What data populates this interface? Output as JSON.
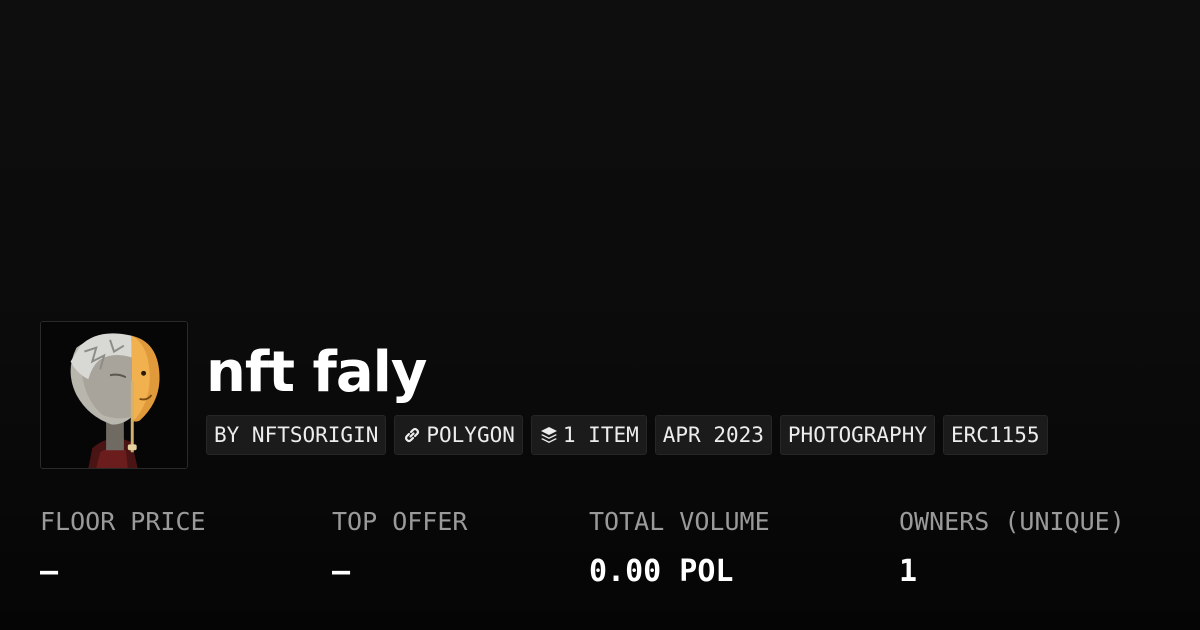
{
  "collection": {
    "name": "nft faly",
    "avatar_alt": "collection avatar"
  },
  "tags": [
    {
      "label": "BY NFTSORIGIN",
      "icon": ""
    },
    {
      "label": "POLYGON",
      "icon": "chain-link-icon"
    },
    {
      "label": "1 ITEM",
      "icon": "layers-icon"
    },
    {
      "label": "APR 2023",
      "icon": ""
    },
    {
      "label": "PHOTOGRAPHY",
      "icon": ""
    },
    {
      "label": "ERC1155",
      "icon": ""
    }
  ],
  "stats": [
    {
      "label": "FLOOR PRICE",
      "value": "–"
    },
    {
      "label": "TOP OFFER",
      "value": "–"
    },
    {
      "label": "TOTAL VOLUME",
      "value": "0.00 POL"
    },
    {
      "label": "OWNERS (UNIQUE)",
      "value": "1"
    }
  ],
  "colors": {
    "background": "#0b0b0b",
    "tag_background": "#1b1b1b",
    "label_gray": "#9a9a9a",
    "text": "#ffffff"
  }
}
